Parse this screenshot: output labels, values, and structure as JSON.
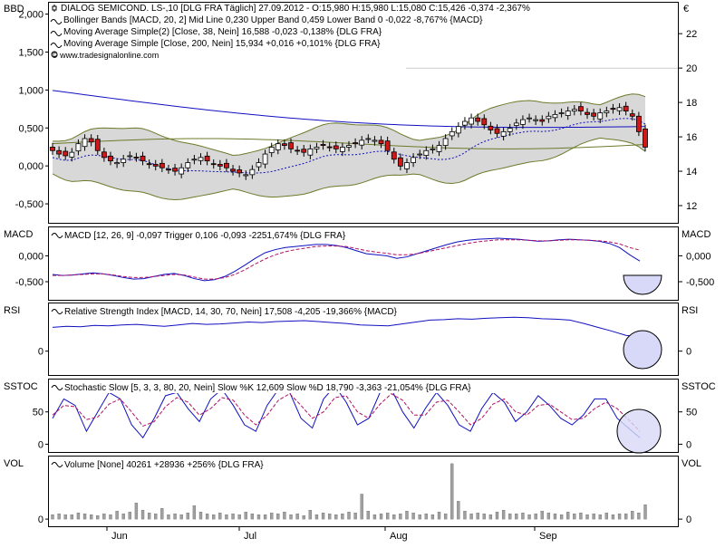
{
  "colors": {
    "frame": "#000000",
    "up_candle": "#ffffff",
    "down_candle": "#d01818",
    "price_line": "#1010c0",
    "bb_fill": "#d8d8d8",
    "bb_band": "#6b7b2a",
    "ma38": "#1010c0",
    "ma200": "#6b7b2a",
    "macd_line": "#1010c0",
    "trigger": "#b01060",
    "volume_bar": "#a0a0a0",
    "highlight_circle": "#d8d8f8"
  },
  "header": {
    "unit_left": "BBD",
    "unit_right": "€",
    "legend": [
      {
        "icon": "candle-icon",
        "text": "DIALOG SEMICOND.   LS-,10 [DLG FRA  Täglich] 27.09.2012 - O:15,980 H:15,980 L:15,080 C:15,426 -0,374 -2,367%"
      },
      {
        "icon": "wave-icon",
        "text": "Bollinger Bands [MACD, 20, 2] Mid Line 0,230 Upper Band 0,459 Lower Band 0 -0,022 -8,767% {MACD}"
      },
      {
        "icon": "wave-icon",
        "text": "Moving Average Simple(2) [Close, 38, Nein] 16,588 -0,023 -0,138% {DLG FRA}"
      },
      {
        "icon": "wave-icon",
        "text": "Moving Average Simple [Close, 200, Nein] 15,934 +0,016 +0,101% {DLG FRA}"
      },
      {
        "icon": "copyright-icon",
        "text": "© www.tradesignalonline.com"
      }
    ]
  },
  "panels": {
    "macd": {
      "label": "MACD",
      "legend": "MACD [12, 26, 9] -0,097 Trigger 0,106 -0,093 -2251,674% {DLG FRA}"
    },
    "rsi": {
      "label": "RSI",
      "legend": "Relative Strength Index [MACD, 14, 30, 70, Nein] 17,508 -4,205 -19,366% {MACD}"
    },
    "sstoc": {
      "label": "SSTOC",
      "legend": "Stochastic Slow [5, 3, 3, 80, 20, Nein] Slow %K 12,609 Slow %D 18,790 -3,363 -21,054% {DLG FRA}"
    },
    "vol": {
      "label": "VOL",
      "legend": "Volume [None] 40261 +28936 +256% {DLG FRA}"
    }
  },
  "chart_data": [
    {
      "type": "candlestick",
      "panel": "main",
      "left_axis_ticks": [
        "2,000",
        "1,500",
        "1,000",
        "0,500",
        "0,000",
        "-0,500"
      ],
      "right_axis_ticks": [
        "22",
        "20",
        "18",
        "16",
        "14",
        "12"
      ],
      "left_ylim": [
        -0.75,
        2.15
      ],
      "right_ylim": [
        11,
        23.8
      ],
      "x_tick_labels": [
        "Jun",
        "Jul",
        "Aug",
        "Sep"
      ],
      "candles_start": "2012-05-21",
      "candles_count": 93,
      "close_eur": [
        15.2,
        15.0,
        14.9,
        15.1,
        15.6,
        15.9,
        15.7,
        15.2,
        14.8,
        14.6,
        14.5,
        14.7,
        14.9,
        14.8,
        14.6,
        14.4,
        14.3,
        14.2,
        14.1,
        14.0,
        14.2,
        14.5,
        14.7,
        14.8,
        14.6,
        14.4,
        14.3,
        14.2,
        14.0,
        13.9,
        13.8,
        14.1,
        14.5,
        15.0,
        15.4,
        15.6,
        15.5,
        15.3,
        15.2,
        15.1,
        15.3,
        15.4,
        15.5,
        15.4,
        15.3,
        15.4,
        15.5,
        15.6,
        15.8,
        15.9,
        15.8,
        15.6,
        15.2,
        14.7,
        14.3,
        14.5,
        14.8,
        15.0,
        15.2,
        15.3,
        15.5,
        15.9,
        16.3,
        16.6,
        16.9,
        17.1,
        16.9,
        16.7,
        16.4,
        16.2,
        16.3,
        16.5,
        16.8,
        17.0,
        17.1,
        17.0,
        16.9,
        17.2,
        17.3,
        17.4,
        17.5,
        17.6,
        17.5,
        17.3,
        17.2,
        17.4,
        17.5,
        17.6,
        17.7,
        17.5,
        17.2,
        16.3,
        15.4
      ],
      "ma38_eur_start": 18.7,
      "ma38_eur_end": 16.6,
      "ma200_eur": 15.9
    },
    {
      "type": "line",
      "panel": "macd",
      "ylabel_ticks": [
        "0,000",
        "-0,500"
      ],
      "ylim": [
        -0.85,
        0.55
      ],
      "series": [
        {
          "name": "MACD",
          "values": [
            -0.36,
            -0.38,
            -0.37,
            -0.35,
            -0.33,
            -0.35,
            -0.38,
            -0.42,
            -0.45,
            -0.44,
            -0.4,
            -0.36,
            -0.34,
            -0.38,
            -0.44,
            -0.48,
            -0.46,
            -0.4,
            -0.3,
            -0.18,
            -0.05,
            0.06,
            0.12,
            0.16,
            0.18,
            0.2,
            0.22,
            0.22,
            0.2,
            0.16,
            0.1,
            0.04,
            0.02,
            0.0,
            -0.05,
            -0.02,
            0.04,
            0.1,
            0.16,
            0.22,
            0.27,
            0.3,
            0.32,
            0.33,
            0.34,
            0.33,
            0.32,
            0.3,
            0.28,
            0.29,
            0.31,
            0.32,
            0.31,
            0.3,
            0.28,
            0.24,
            0.16,
            0.02,
            -0.1
          ]
        },
        {
          "name": "Trigger",
          "values": [
            -0.38,
            -0.38,
            -0.37,
            -0.36,
            -0.35,
            -0.35,
            -0.37,
            -0.4,
            -0.42,
            -0.42,
            -0.4,
            -0.38,
            -0.36,
            -0.37,
            -0.41,
            -0.45,
            -0.45,
            -0.42,
            -0.36,
            -0.27,
            -0.16,
            -0.06,
            0.02,
            0.08,
            0.12,
            0.15,
            0.18,
            0.19,
            0.19,
            0.18,
            0.14,
            0.1,
            0.07,
            0.05,
            0.02,
            0.02,
            0.04,
            0.08,
            0.12,
            0.16,
            0.2,
            0.24,
            0.27,
            0.29,
            0.31,
            0.31,
            0.31,
            0.3,
            0.29,
            0.29,
            0.3,
            0.31,
            0.31,
            0.3,
            0.29,
            0.27,
            0.23,
            0.16,
            0.11
          ]
        }
      ]
    },
    {
      "type": "line",
      "panel": "rsi",
      "ylabel_ticks": [
        "0"
      ],
      "ylim": [
        -50,
        100
      ],
      "series": [
        {
          "name": "RSI",
          "values": [
            50,
            52,
            51,
            54,
            53,
            55,
            56,
            54,
            52,
            55,
            58,
            56,
            57,
            59,
            61,
            60,
            62,
            63,
            64,
            62,
            60,
            58,
            55,
            54,
            53,
            57,
            61,
            65,
            66,
            68,
            67,
            69,
            70,
            71,
            70,
            68,
            67,
            65,
            58,
            50,
            42,
            33,
            30
          ]
        }
      ]
    },
    {
      "type": "line",
      "panel": "sstoc",
      "ylabel_ticks": [
        "50",
        "0"
      ],
      "ylim": [
        -12,
        100
      ],
      "series": [
        {
          "name": "Slow %K",
          "values": [
            40,
            70,
            60,
            20,
            50,
            80,
            70,
            30,
            10,
            40,
            75,
            80,
            55,
            35,
            70,
            85,
            60,
            30,
            20,
            60,
            85,
            80,
            40,
            25,
            70,
            90,
            65,
            30,
            40,
            80,
            85,
            50,
            25,
            55,
            80,
            60,
            30,
            20,
            55,
            80,
            65,
            35,
            50,
            75,
            60,
            40,
            30,
            45,
            70,
            70,
            40,
            25,
            10
          ]
        },
        {
          "name": "Slow %D",
          "values": [
            45,
            60,
            58,
            38,
            42,
            62,
            70,
            50,
            28,
            35,
            58,
            72,
            65,
            45,
            55,
            72,
            68,
            45,
            30,
            45,
            68,
            78,
            60,
            40,
            50,
            72,
            75,
            50,
            40,
            62,
            78,
            68,
            45,
            45,
            65,
            68,
            50,
            30,
            40,
            62,
            70,
            50,
            45,
            60,
            62,
            50,
            38,
            40,
            55,
            65,
            55,
            38,
            20
          ]
        }
      ]
    },
    {
      "type": "bar",
      "panel": "vol",
      "ylabel_ticks": [
        "0"
      ],
      "values": [
        5,
        6,
        5,
        5,
        7,
        6,
        5,
        4,
        6,
        5,
        9,
        6,
        8,
        18,
        10,
        7,
        6,
        12,
        5,
        6,
        5,
        7,
        15,
        8,
        6,
        5,
        7,
        5,
        6,
        5,
        8,
        6,
        5,
        5,
        7,
        6,
        8,
        5,
        6,
        4,
        10,
        5,
        7,
        6,
        5,
        6,
        8,
        7,
        28,
        9,
        5,
        6,
        7,
        5,
        6,
        9,
        7,
        5,
        6,
        5,
        8,
        6,
        62,
        20,
        9,
        6,
        7,
        6,
        5,
        8,
        10,
        6,
        6,
        7,
        5,
        6,
        9,
        7,
        6,
        5,
        8,
        6,
        7,
        5,
        6,
        5,
        7,
        5,
        6,
        6,
        9,
        7,
        16
      ],
      "ylim": [
        -8,
        70
      ]
    }
  ]
}
